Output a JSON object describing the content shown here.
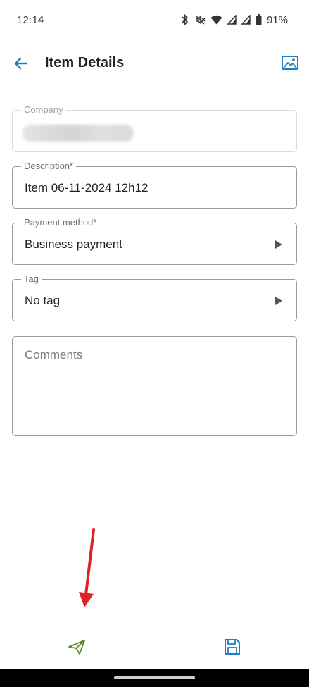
{
  "status_bar": {
    "time": "12:14",
    "battery": "91%",
    "icons": [
      "bluetooth-icon",
      "mute-icon",
      "wifi-icon",
      "signal-icon",
      "signal-icon",
      "battery-icon"
    ]
  },
  "header": {
    "title": "Item Details",
    "back_icon": "arrow-left-icon",
    "image_icon": "image-icon"
  },
  "form": {
    "company": {
      "label": "Company",
      "value": "",
      "redacted": true
    },
    "description": {
      "label": "Description*",
      "value": "Item 06-11-2024 12h12"
    },
    "payment_method": {
      "label": "Payment method*",
      "value": "Business payment"
    },
    "tag": {
      "label": "Tag",
      "value": "No tag"
    },
    "comments": {
      "placeholder": "Comments"
    }
  },
  "bottom_bar": {
    "send_icon": "send-icon",
    "save_icon": "save-icon"
  },
  "colors": {
    "accent": "#1a7fc4",
    "send": "#5a8a1e",
    "annotation": "#e0202a"
  }
}
